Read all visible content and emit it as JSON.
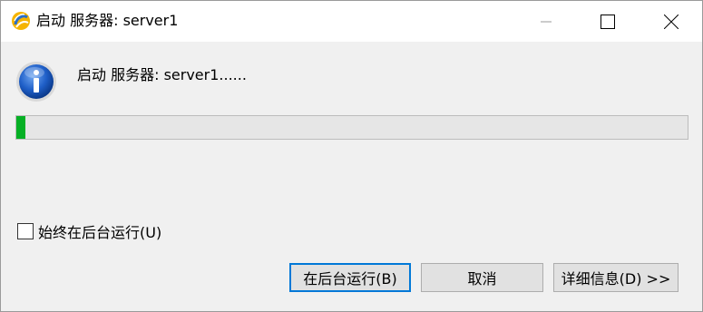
{
  "window": {
    "title": "启动 服务器: server1",
    "icon": "eclipse-app-icon",
    "controls": {
      "minimize": "minimize-icon",
      "maximize": "maximize-icon",
      "close": "close-icon"
    }
  },
  "dialog": {
    "icon": "info-icon",
    "message": "启动 服务器: server1......",
    "progress": {
      "fraction": 0.013,
      "fill_color": "#06b025"
    },
    "checkbox": {
      "label": "始终在后台运行(U)",
      "checked": false
    },
    "buttons": {
      "background": "在后台运行(B)",
      "cancel": "取消",
      "details": "详细信息(D) >>"
    }
  }
}
